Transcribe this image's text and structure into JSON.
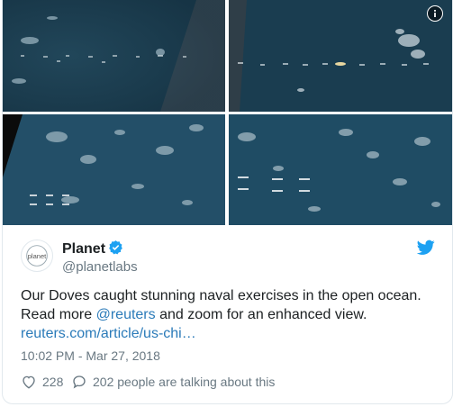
{
  "media": {
    "info_icon": "info-icon",
    "tiles": [
      {
        "alt_icon": "satellite-image"
      },
      {
        "alt_icon": "satellite-image"
      },
      {
        "alt_icon": "satellite-image"
      },
      {
        "alt_icon": "satellite-image"
      }
    ]
  },
  "author": {
    "avatar_text": "planet",
    "name": "Planet",
    "handle": "@planetlabs",
    "verified_icon": "verified-badge-icon"
  },
  "brand_icon": "twitter-bird-icon",
  "tweet": {
    "line1": "Our Doves caught stunning naval exercises in the open ocean.",
    "line2_prefix": "Read more ",
    "mention": "@reuters",
    "line2_suffix": " and zoom for an enhanced view.",
    "url": "reuters.com/article/us-chi…"
  },
  "timestamp": "10:02 PM - Mar 27, 2018",
  "actions": {
    "like_icon": "heart-icon",
    "like_count": "228",
    "reply_icon": "speech-bubble-icon",
    "reply_text": "202 people are talking about this"
  },
  "colors": {
    "link": "#2b7bb9",
    "verified": "#1da1f2",
    "secondary_text": "#697882",
    "ocean_dark": "#16394d",
    "ocean": "#1f4a63"
  }
}
